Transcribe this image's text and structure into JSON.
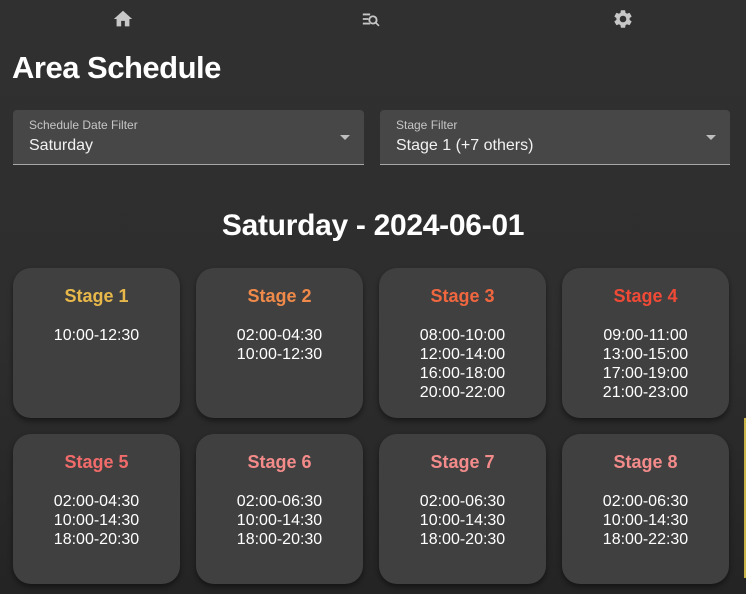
{
  "nav": {
    "items": [
      {
        "name": "home-icon"
      },
      {
        "name": "search-list-icon"
      },
      {
        "name": "gear-icon"
      }
    ]
  },
  "page": {
    "title": "Area Schedule"
  },
  "filters": {
    "date": {
      "label": "Schedule Date Filter",
      "value": "Saturday"
    },
    "stage": {
      "label": "Stage Filter",
      "value": "Stage 1 (+7 others)"
    }
  },
  "schedule": {
    "heading": "Saturday - 2024-06-01",
    "stages": [
      {
        "name": "Stage 1",
        "color": "#e8b84a",
        "times": [
          "10:00-12:30"
        ]
      },
      {
        "name": "Stage 2",
        "color": "#ef8a4a",
        "times": [
          "02:00-04:30",
          "10:00-12:30"
        ]
      },
      {
        "name": "Stage 3",
        "color": "#f0673f",
        "times": [
          "08:00-10:00",
          "12:00-14:00",
          "16:00-18:00",
          "20:00-22:00"
        ]
      },
      {
        "name": "Stage 4",
        "color": "#f04a37",
        "times": [
          "09:00-11:00",
          "13:00-15:00",
          "17:00-19:00",
          "21:00-23:00"
        ]
      },
      {
        "name": "Stage 5",
        "color": "#f26b6b",
        "times": [
          "02:00-04:30",
          "10:00-14:30",
          "18:00-20:30"
        ]
      },
      {
        "name": "Stage 6",
        "color": "#f48b8b",
        "times": [
          "02:00-06:30",
          "10:00-14:30",
          "18:00-20:30"
        ]
      },
      {
        "name": "Stage 7",
        "color": "#f48b8b",
        "times": [
          "02:00-06:30",
          "10:00-14:30",
          "18:00-20:30"
        ]
      },
      {
        "name": "Stage 8",
        "color": "#f48b8b",
        "times": [
          "02:00-06:30",
          "10:00-14:30",
          "18:00-22:30"
        ]
      }
    ]
  }
}
